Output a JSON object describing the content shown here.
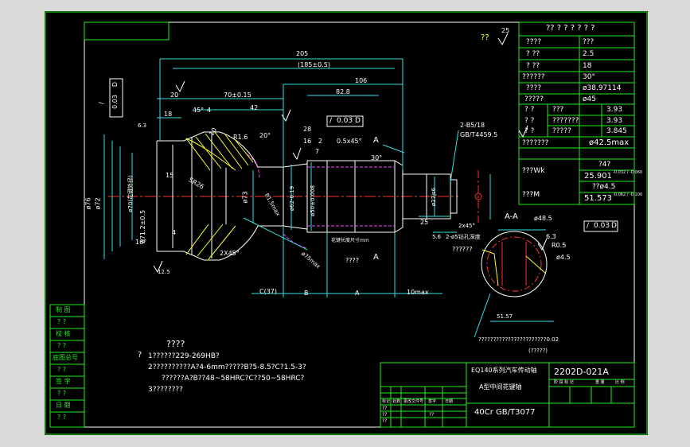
{
  "drawing": {
    "drawing_number": "2202D-021A",
    "material": "40Cr GB/T3077",
    "title_line1": "EQ140系列汽车传动轴",
    "title_line2": "A型中间花键轴",
    "roughness_header": "??",
    "roughness_top": "25"
  },
  "spline_table": {
    "header": "?? ? ? ? ? ? ?",
    "rows": [
      {
        "label": "????",
        "value": "???"
      },
      {
        "label": "?   ??",
        "value": "2.5"
      },
      {
        "label": "?   ??",
        "value": "18"
      },
      {
        "label": "??????",
        "value": "30°"
      },
      {
        "label": "????",
        "value": "ø38.97114"
      },
      {
        "label": "?????",
        "value": "ø45"
      },
      {
        "label": "?   ?",
        "sub": "???",
        "value": "3.93"
      },
      {
        "label": "?   ?",
        "sub": "???????",
        "value": "3.93"
      },
      {
        "label": "?   ?",
        "sub": "?????",
        "value": "3.845"
      },
      {
        "label": "???????",
        "value": "ø42.5max"
      },
      {
        "label": "???Wk",
        "value1": "?4?",
        "value2": "25.901",
        "tol": "-0.032 / -0.060"
      },
      {
        "label": "???M",
        "value1": "??ø4.5",
        "value2": "51.573",
        "tol": "-0.062 / -0.100"
      }
    ]
  },
  "dimensions": {
    "d205": "205",
    "d185": "(185±0.5)",
    "d106": "106",
    "d82_8": "82.8",
    "d20": "20",
    "d70_15": "70±0.15",
    "d42": "42",
    "d18": "18",
    "d45deg": "45°",
    "d4": "4",
    "d10": "10",
    "d28": "28",
    "d16": "16",
    "d7": "7",
    "d2": "2",
    "d30deg": "30°",
    "d05_45": "0.5x45°",
    "d2_b5": "2-B5/18",
    "gb4459": "GB/T4459.5",
    "d25": "25",
    "d2x45": "2x45°",
    "d5_6": "5.6",
    "b5_note": "2-ø5钻孔深度",
    "d6_3": "6.3",
    "d12_5": "12.5",
    "r1_6": "R1.6",
    "r1_5": "R1.5max",
    "d20deg": "20°",
    "sr26": "SR26",
    "d15": "15",
    "d16deg": "16°",
    "d2x45b": "2X45°",
    "d4b": "4",
    "phi76": "ø76",
    "phi72": "ø72",
    "phi71": "ø71.2±0.5",
    "phi70": "ø70(花键外径)",
    "phi73": "ø73",
    "phi62": "ø62-0.19",
    "phi50": "ø50±0.008",
    "phi27": "ø27js6",
    "c37": "C(37)",
    "b": "B",
    "a": "A",
    "d10max": "10max",
    "a_mark": "A",
    "qqqq": "????",
    "q6": "??????",
    "note_len": "花键长度尺寸mm",
    "note_p75": "ø75max"
  },
  "tolerances": {
    "fcf1_sym": "/",
    "fcf1_val": "0.03",
    "fcf1_ref": "D",
    "fcf2_sym": "/",
    "fcf2_val": "0.03",
    "fcf2_ref": "D",
    "fcf3_sym": "/",
    "fcf3_val": "0.03",
    "fcf3_ref": "D"
  },
  "section": {
    "label": "A-A",
    "phi48": "ø48.5",
    "r05": "R0.5",
    "phi45": "ø4.5",
    "d51_57": "51.57",
    "note": "???????????????????????0.02",
    "paren": "(?????)",
    "r6_3": "6.3"
  },
  "notes": {
    "title": "????",
    "q": "?",
    "lines": [
      "1??????229-269HB?",
      "2??????????A?4-6mm?????B?5-8.5?C?1.5-3?",
      "??????A?B??48~58HRC?C??50~58HRC?",
      "3????????"
    ]
  },
  "side_labels": [
    "制  图",
    "? ?",
    "校  核",
    "? ?",
    "底图总号",
    "? ?",
    "签  字",
    "? ?",
    "日  期",
    "? ?"
  ],
  "title_block": {
    "grid_labels": [
      "标记",
      "处数",
      "更改文件号",
      "签字",
      "日期"
    ],
    "q_labels": [
      "??",
      "??",
      "??",
      "??"
    ],
    "small_labels": [
      "阶  段  标  记",
      "重  量",
      "比  例"
    ]
  }
}
